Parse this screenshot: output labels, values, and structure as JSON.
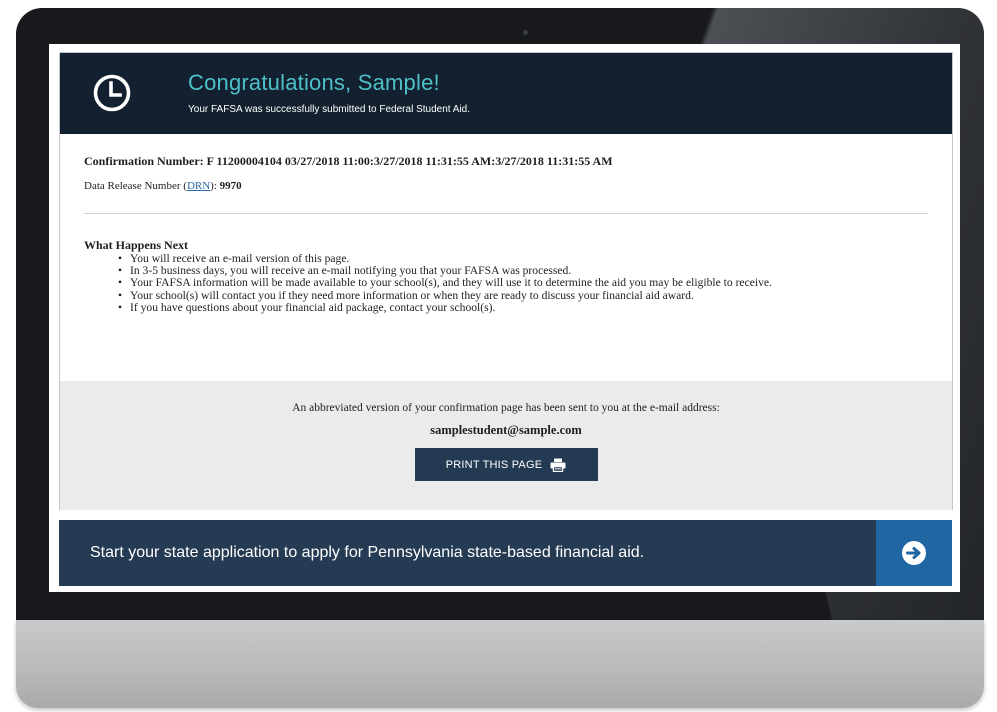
{
  "banner": {
    "title": "Congratulations, Sample!",
    "subtitle": "Your FAFSA was successfully submitted to Federal Student Aid.",
    "icon": "clock-icon"
  },
  "confirmation": {
    "label": "Confirmation Number:",
    "value": "F 11200004104 03/27/2018 11:00:3/27/2018 11:31:55 AM:3/27/2018 11:31:55 AM",
    "drn_prefix": "Data Release Number (",
    "drn_link": "DRN",
    "drn_suffix": "):",
    "drn_value": "9970"
  },
  "next": {
    "title": "What Happens Next",
    "items": [
      "You will receive an e-mail version of this page.",
      "In 3-5 business days, you will receive an e-mail notifying you that your FAFSA was processed.",
      "Your FAFSA information will be made available to your school(s), and they will use it to determine the aid you may be eligible to receive.",
      "Your school(s) will contact you if they need more information or when they are ready to discuss your financial aid award.",
      "If you have questions about your financial aid package, contact your school(s)."
    ]
  },
  "email_notice": {
    "text": "An abbreviated version of your confirmation page has been sent to you at the e-mail address:",
    "address": "samplestudent@sample.com",
    "print_label": "PRINT THIS PAGE",
    "print_icon": "printer-icon"
  },
  "state_bar": {
    "text": "Start your state application to apply for Pennsylvania state-based financial aid.",
    "icon": "arrow-right-circle-icon"
  },
  "colors": {
    "banner_bg": "#12202f",
    "title_teal": "#4ec0c7",
    "button_navy": "#243a52",
    "state_bar_bg": "#253b53",
    "arrow_blue": "#1f66a3"
  }
}
